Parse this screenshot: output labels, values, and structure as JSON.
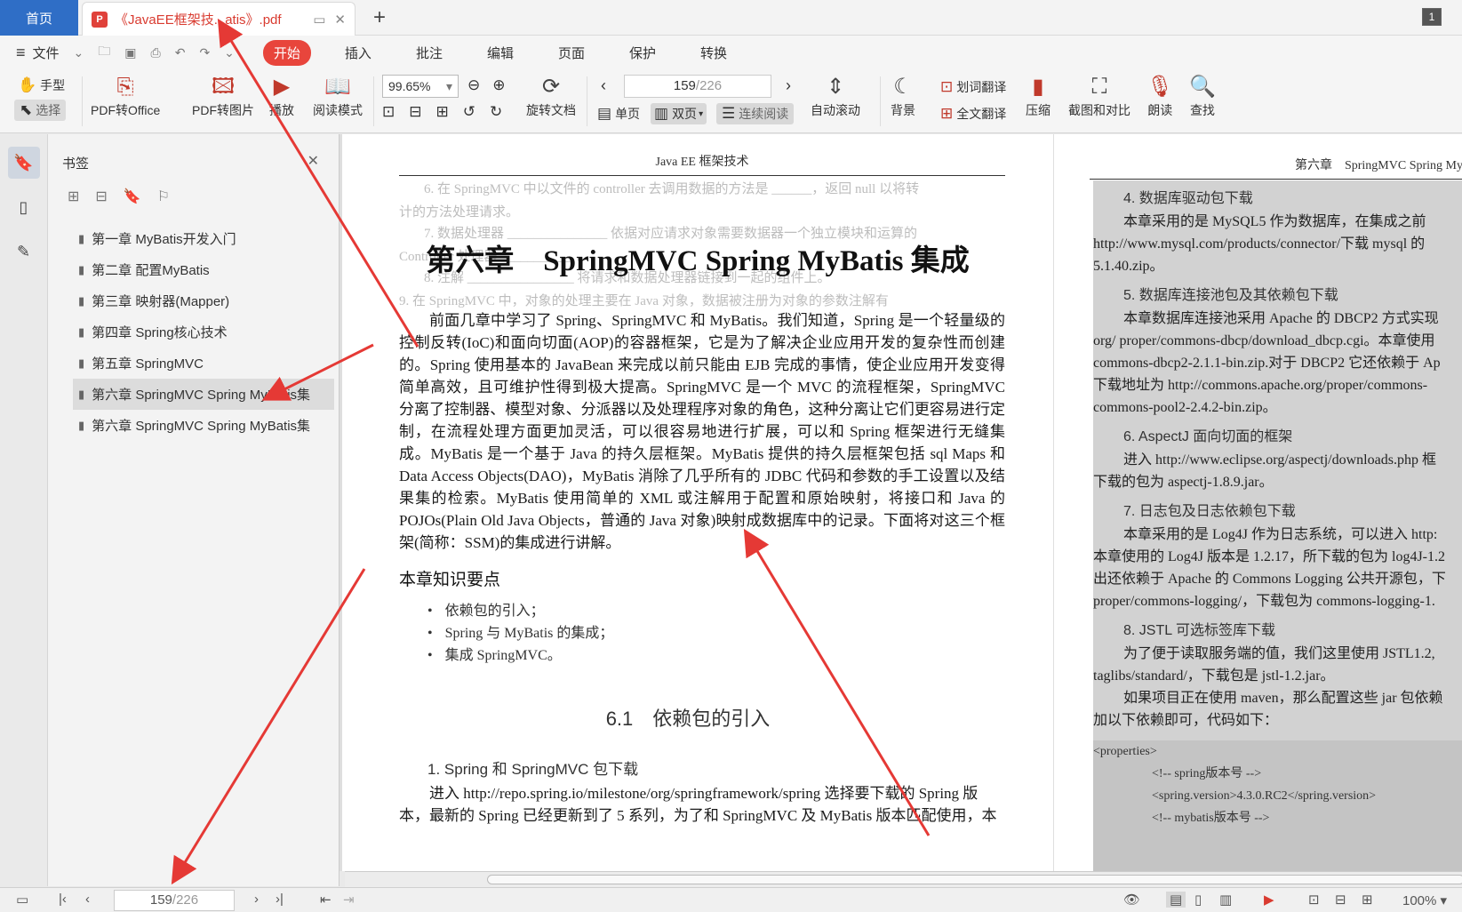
{
  "titlebar": {
    "home": "首页",
    "doc_tab": "《JavaEE框架技...atis》.pdf",
    "window_count": "1"
  },
  "menu": {
    "file": "文件",
    "items": [
      "开始",
      "插入",
      "批注",
      "编辑",
      "页面",
      "保护",
      "转换"
    ],
    "active": "开始"
  },
  "toolbar": {
    "hand": "手型",
    "select": "选择",
    "pdf_office": "PDF转Office",
    "pdf_image": "PDF转图片",
    "play": "播放",
    "read_mode": "阅读模式",
    "zoom": "99.65%",
    "rotate": "旋转文档",
    "page_current": "159",
    "page_total": "/226",
    "single": "单页",
    "double": "双页",
    "continuous": "连续阅读",
    "auto_scroll": "自动滚动",
    "background": "背景",
    "word_translate": "划词翻译",
    "full_translate": "全文翻译",
    "compress": "压缩",
    "screenshot": "截图和对比",
    "read_aloud": "朗读",
    "find": "查找"
  },
  "sidebar": {
    "title": "书签",
    "bookmarks": [
      "第一章 MyBatis开发入门",
      "第二章 配置MyBatis",
      "第三章 映射器(Mapper)",
      "第四章 Spring核心技术",
      "第五章 SpringMVC",
      "第六章 SpringMVC Spring MyBatis集",
      "第六章 SpringMVC Spring MyBatis集"
    ],
    "selected_index": 5
  },
  "page1": {
    "header": "Java EE 框架技术",
    "ghost_lines": [
      "6. 在 SpringMVC 中以文件的 controller 去调用数据的方法是 ______，返回 null 以将转",
      "计的方法处理请求。",
      "7. 数据处理器 _______________ 依据对应请求对象需要数据器一个独立模块和运算的",
      "Controller 处理器 ___________ 。",
      "8. 注解 ________________ 将请求和数据处理器链接到一起的组件上。",
      "9. 在 SpringMVC 中，对象的处理主要在 Java 对象，数据被注册为对象的参数注解有"
    ],
    "chapter_title": "第六章　SpringMVC Spring MyBatis 集成",
    "intro": "前面几章中学习了 Spring、SpringMVC 和 MyBatis。我们知道，Spring 是一个轻量级的控制反转(IoC)和面向切面(AOP)的容器框架，它是为了解决企业应用开发的复杂性而创建的。Spring 使用基本的 JavaBean 来完成以前只能由 EJB 完成的事情，使企业应用开发变得简单高效，且可维护性得到极大提高。SpringMVC 是一个 MVC 的流程框架，SpringMVC 分离了控制器、模型对象、分派器以及处理程序对象的角色，这种分离让它们更容易进行定制，在流程处理方面更加灵活，可以很容易地进行扩展，可以和 Spring 框架进行无缝集成。MyBatis 是一个基于 Java 的持久层框架。MyBatis 提供的持久层框架包括 sql Maps 和 Data Access Objects(DAO)，MyBatis 消除了几乎所有的 JDBC 代码和参数的手工设置以及结果集的检索。MyBatis 使用简单的 XML 或注解用于配置和原始映射，将接口和 Java 的 POJOs(Plain Old Java Objects，普通的 Java 对象)映射成数据库中的记录。下面将对这三个框架(简称：SSM)的集成进行讲解。",
    "key_points_title": "本章知识要点",
    "key_points": [
      "依赖包的引入；",
      "Spring 与 MyBatis 的集成；",
      "集成 SpringMVC。"
    ],
    "section_num": "6.1",
    "section_title": "依赖包的引入",
    "sub1": "1. Spring 和 SpringMVC 包下载",
    "tail": "进入 http://repo.spring.io/milestone/org/springframework/spring 选择要下载的 Spring 版本，最新的 Spring 已经更新到了 5 系列，为了和 SpringMVC 及 MyBatis 版本匹配使用，本"
  },
  "page2": {
    "header": "第六章　SpringMVC Spring My",
    "blocks": [
      {
        "h": "4. 数据库驱动包下载"
      },
      {
        "t": "本章采用的是 MySQL5 作为数据库，在集成之前",
        "in": true
      },
      {
        "t": "http://www.mysql.com/products/connector/下载 mysql 的"
      },
      {
        "t": "5.1.40.zip。"
      },
      {
        "h": "5. 数据库连接池包及其依赖包下载"
      },
      {
        "t": "本章数据库连接池采用 Apache 的 DBCP2 方式实现",
        "in": true
      },
      {
        "t": "org/ proper/commons-dbcp/download_dbcp.cgi。本章使用"
      },
      {
        "t": "commons-dbcp2-2.1.1-bin.zip.对于 DBCP2 它还依赖于 Ap"
      },
      {
        "t": "下载地址为 http://commons.apache.org/proper/commons-"
      },
      {
        "t": "commons-pool2-2.4.2-bin.zip。"
      },
      {
        "h": "6. AspectJ 面向切面的框架"
      },
      {
        "t": "进入 http://www.eclipse.org/aspectj/downloads.php 框",
        "in": true
      },
      {
        "t": "下载的包为 aspectj-1.8.9.jar。"
      },
      {
        "h": "7. 日志包及日志依赖包下载"
      },
      {
        "t": "本章采用的是 Log4J 作为日志系统，可以进入 http:",
        "in": true
      },
      {
        "t": "本章使用的 Log4J 版本是 1.2.17，所下载的包为 log4J-1.2"
      },
      {
        "t": "出还依赖于 Apache 的 Commons Logging 公共开源包，下"
      },
      {
        "t": "proper/commons-logging/，下载包为 commons-logging-1."
      },
      {
        "h": "8. JSTL 可选标签库下载"
      },
      {
        "t": "为了便于读取服务端的值，我们这里使用 JSTL1.2,",
        "in": true
      },
      {
        "t": "taglibs/standard/，下载包是 jstl-1.2.jar。"
      },
      {
        "t": "如果项目正在使用 maven，那么配置这些 jar 包依赖",
        "in": true
      },
      {
        "t": "加以下依赖即可，代码如下："
      }
    ],
    "code": [
      "<properties>",
      "<!-- spring版本号 -->",
      "<spring.version>4.3.0.RC2</spring.version>",
      "<!-- mybatis版本号 -->"
    ]
  },
  "statusbar": {
    "page_current": "159",
    "page_total": "/226",
    "zoom": "100%"
  }
}
